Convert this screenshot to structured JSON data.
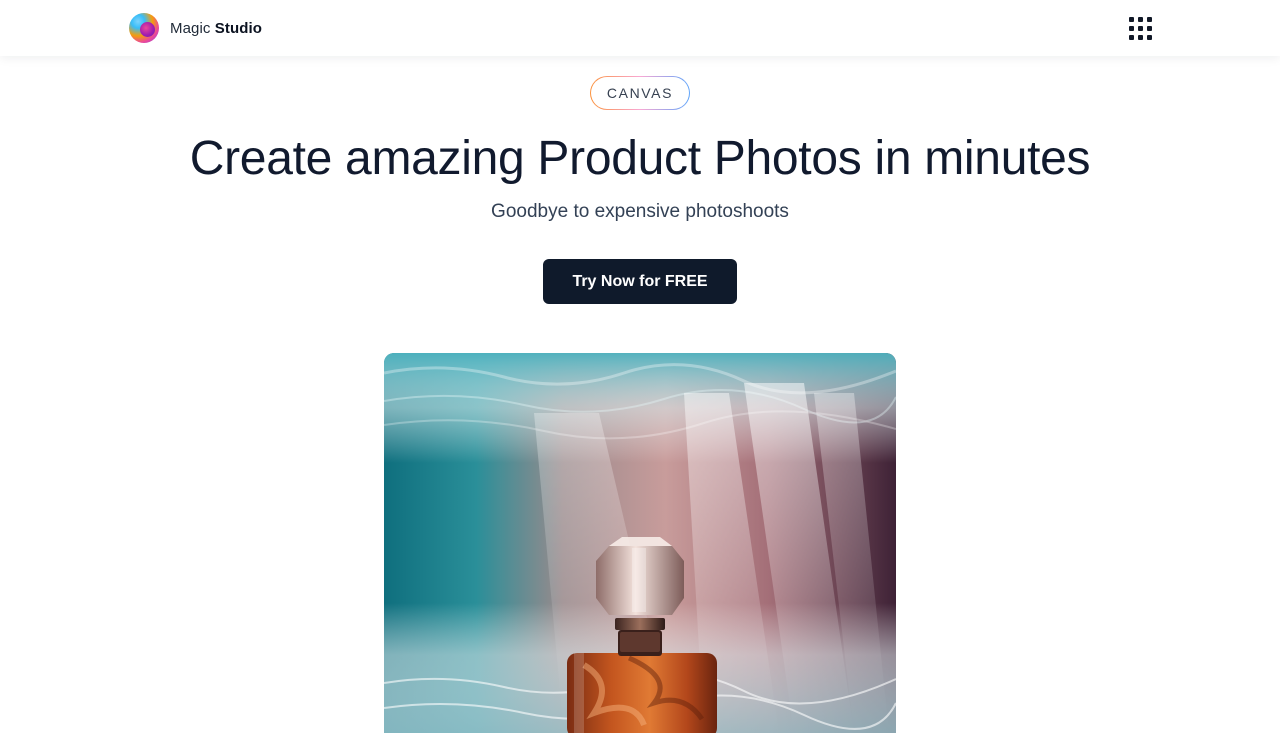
{
  "header": {
    "brand": {
      "name_light": "Magic",
      "name_bold": "Studio",
      "logo_icon": "magic-studio-logo-icon"
    },
    "apps_menu_icon": "grid-dots-icon"
  },
  "hero": {
    "badge": "CANVAS",
    "headline": "Create amazing Product Photos in minutes",
    "subheadline": "Goodbye to expensive photoshoots",
    "cta_label": "Try Now for FREE",
    "showcase_image": "underwater perfume bottle product photo"
  },
  "colors": {
    "cta_background": "#0f1a2b",
    "headline": "#111a2e",
    "badge_border_gradient": [
      "#fb923c",
      "#f9a8d4",
      "#60a5fa"
    ]
  }
}
